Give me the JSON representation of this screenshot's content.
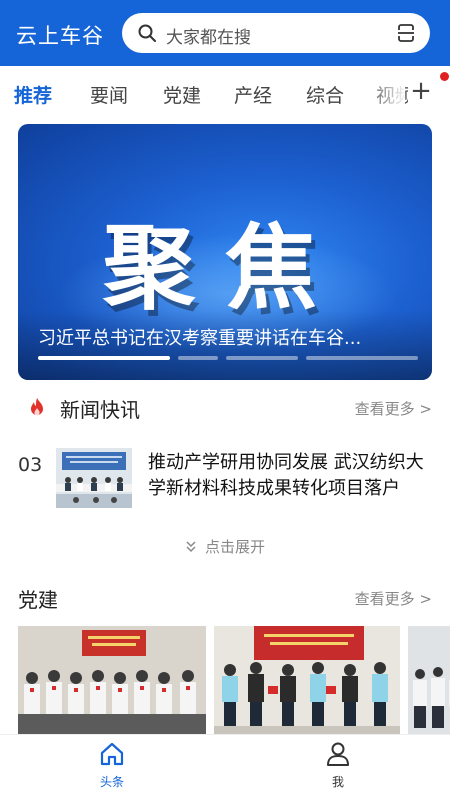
{
  "header": {
    "app_title": "云上车谷",
    "search_placeholder": "大家都在搜",
    "brand_color": "#1565d8"
  },
  "tabs": [
    {
      "label": "推荐",
      "active": true
    },
    {
      "label": "要闻",
      "active": false
    },
    {
      "label": "党建",
      "active": false
    },
    {
      "label": "产经",
      "active": false
    },
    {
      "label": "综合",
      "active": false
    },
    {
      "label": "视频",
      "active": false
    }
  ],
  "tab_add_icon": "plus-icon",
  "banner": {
    "headline": "聚焦",
    "caption": "习近平总书记在汉考察重要讲话在车谷...",
    "slides_total": 4,
    "active_slide": 1
  },
  "news_flash": {
    "title": "新闻快讯",
    "more_label": "查看更多 >",
    "items": [
      {
        "index": "03",
        "text": "推动产学研用协同发展 武汉纺织大学新材料科技成果转化项目落户"
      }
    ],
    "expand_label": "点击展开"
  },
  "party_section": {
    "title": "党建",
    "more_label": "查看更多 >"
  },
  "bottom_nav": [
    {
      "label": "头条",
      "icon": "home-icon",
      "active": true
    },
    {
      "label": "我",
      "icon": "user-icon",
      "active": false
    }
  ]
}
